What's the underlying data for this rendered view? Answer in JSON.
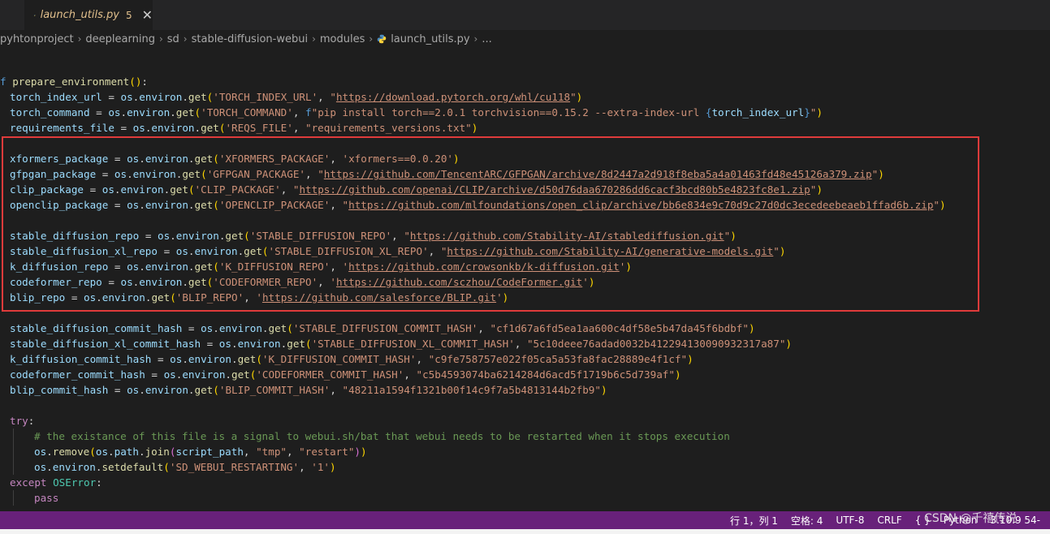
{
  "tab": {
    "filename": "launch_utils.py",
    "problem_count": "5",
    "close_symbol": "✕",
    "icon": "python-file-icon"
  },
  "breadcrumb": [
    "pyhtonproject",
    "deeplearning",
    "sd",
    "stable-diffusion-webui",
    "modules",
    "launch_utils.py",
    "..."
  ],
  "code": {
    "def_name": "prepare_environment",
    "torch_index_url": "https://download.pytorch.org/whl/cu118",
    "torch_command_str": "pip install torch==2.0.1 torchvision==0.15.2 --extra-index-url ",
    "torch_command_var": "torch_index_url",
    "reqs_file": "\"requirements_versions.txt\"",
    "xformers": "'xformers==0.0.20'",
    "gfpgan": "https://github.com/TencentARC/GFPGAN/archive/8d2447a2d918f8eba5a4a01463fd48e45126a379.zip",
    "clip": "https://github.com/openai/CLIP/archive/d50d76daa670286dd6cacf3bcd80b5e4823fc8e1.zip",
    "openclip": "https://github.com/mlfoundations/open_clip/archive/bb6e834e9c70d9c27d0dc3ecedeebeaeb1ffad6b.zip",
    "sd_repo": "https://github.com/Stability-AI/stablediffusion.git",
    "sdxl_repo": "https://github.com/Stability-AI/generative-models.git",
    "kdiff_repo": "https://github.com/crowsonkb/k-diffusion.git",
    "codeformer_repo": "https://github.com/sczhou/CodeFormer.git",
    "blip_repo": "https://github.com/salesforce/BLIP.git",
    "sd_hash": "\"cf1d67a6fd5ea1aa600c4df58e5b47da45f6bdbf\"",
    "sdxl_hash": "\"5c10deee76adad0032b412294130090932317a87\"",
    "kdiff_hash": "\"c9fe758757e022f05ca5a53fa8fac28889e4f1cf\"",
    "codeformer_hash": "\"c5b4593074ba6214284d6acd5f1719b6c5d739af\"",
    "blip_hash": "\"48211a1594f1321b00f14c9f7a5b4813144b2fb9\"",
    "comment": "# the existance of this file is a signal to webui.sh/bat that webui needs to be restarted when it stops execution",
    "tmp": "\"tmp\"",
    "restart": "\"restart\"",
    "sd_webui_restarting": "'SD_WEBUI_RESTARTING'",
    "one": "'1'"
  },
  "statusbar": {
    "position": "行 1，列 1",
    "spaces": "空格: 4",
    "encoding": "UTF-8",
    "eol": "CRLF",
    "language": "Python",
    "version": "3.10.9 54-",
    "watermark": "CSDN @千禧传说"
  },
  "colors": {
    "statusbar": "#68217a",
    "highlight_box": "#e03b3b",
    "editor_bg": "#1e1e1e"
  }
}
